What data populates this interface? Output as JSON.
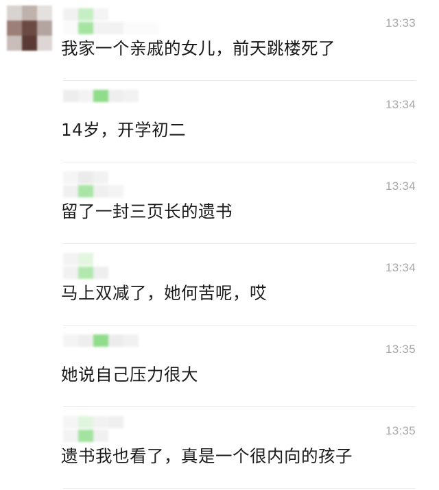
{
  "messages": [
    {
      "sender": "",
      "time": "13:33",
      "text": "我家一个亲戚的女儿，前天跳楼死了"
    },
    {
      "sender": "",
      "time": "13:34",
      "text": "14岁，开学初二"
    },
    {
      "sender": "",
      "time": "13:34",
      "text": "留了一封三页长的遗书"
    },
    {
      "sender": "",
      "time": "13:34",
      "text": "马上双减了，她何苦呢，哎"
    },
    {
      "sender": "",
      "time": "13:35",
      "text": "她说自己压力很大"
    },
    {
      "sender": "",
      "time": "13:35",
      "text": "遗书我也看了，真是一个很内向的孩子"
    }
  ],
  "colors": {
    "timestamp": "#a9a9a9",
    "message_text": "#1a1a1a",
    "divider": "#e9e9e9",
    "name_mosaic_green": "#8fdc8a",
    "name_mosaic_gray": "#ececec"
  }
}
